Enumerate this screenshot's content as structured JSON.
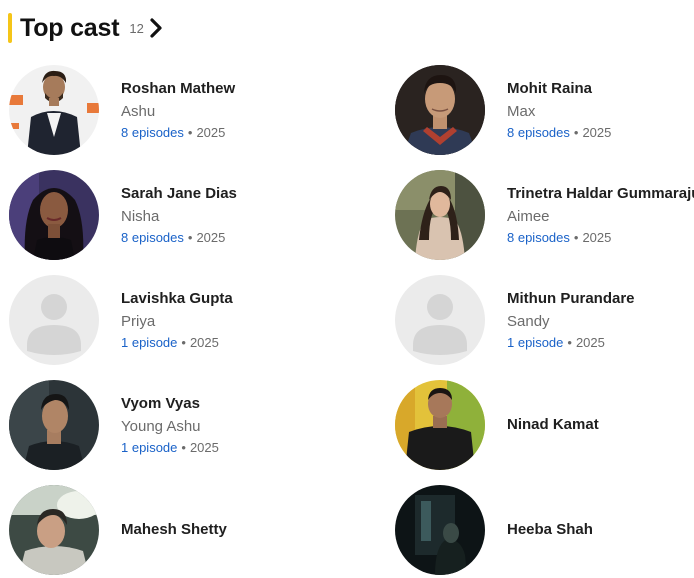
{
  "section": {
    "title": "Top cast",
    "count": "12",
    "chevron_icon": "chevron-right-icon",
    "accent_color": "#f5c518"
  },
  "cast": [
    {
      "name": "Roshan Mathew",
      "role": "Ashu",
      "episodes": "8 episodes",
      "year": "2025",
      "photo": "photo"
    },
    {
      "name": "Mohit Raina",
      "role": "Max",
      "episodes": "8 episodes",
      "year": "2025",
      "photo": "photo"
    },
    {
      "name": "Sarah Jane Dias",
      "role": "Nisha",
      "episodes": "8 episodes",
      "year": "2025",
      "photo": "photo"
    },
    {
      "name": "Trinetra Haldar Gummaraju",
      "role": "Aimee",
      "episodes": "8 episodes",
      "year": "2025",
      "photo": "photo"
    },
    {
      "name": "Lavishka Gupta",
      "role": "Priya",
      "episodes": "1 episode",
      "year": "2025",
      "photo": "placeholder"
    },
    {
      "name": "Mithun Purandare",
      "role": "Sandy",
      "episodes": "1 episode",
      "year": "2025",
      "photo": "placeholder"
    },
    {
      "name": "Vyom Vyas",
      "role": "Young Ashu",
      "episodes": "1 episode",
      "year": "2025",
      "photo": "photo"
    },
    {
      "name": "Ninad Kamat",
      "photo": "photo"
    },
    {
      "name": "Mahesh Shetty",
      "photo": "photo"
    },
    {
      "name": "Heeba Shah",
      "photo": "photo"
    }
  ]
}
